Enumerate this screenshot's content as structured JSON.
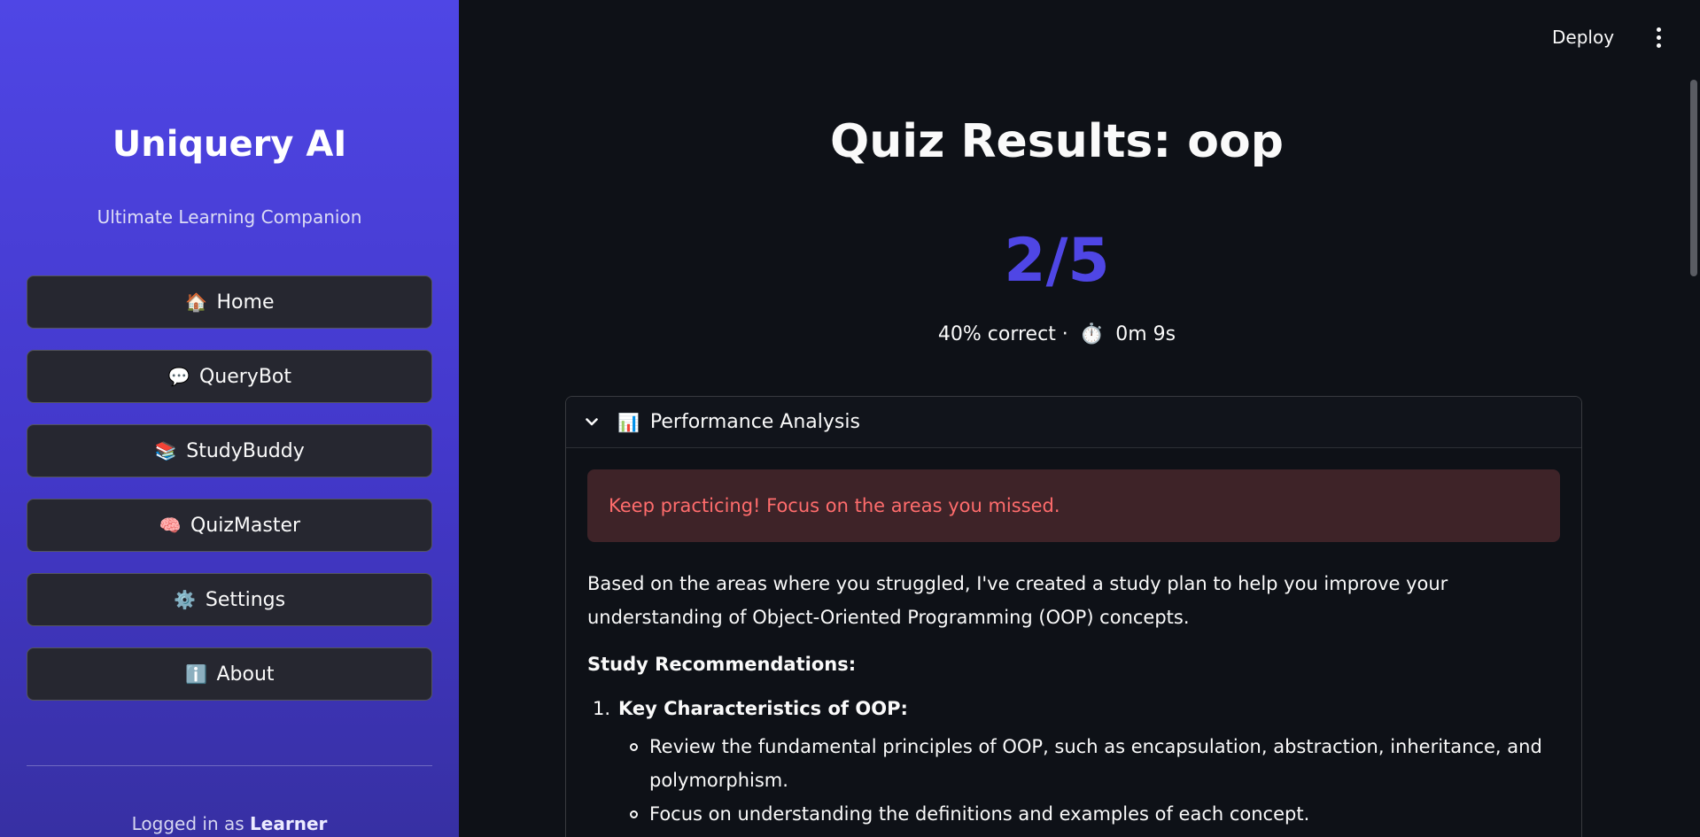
{
  "sidebar": {
    "title": "Uniquery AI",
    "subtitle": "Ultimate Learning Companion",
    "nav": [
      {
        "icon": "🏠",
        "icon_name": "home-icon",
        "label": "Home"
      },
      {
        "icon": "💬",
        "icon_name": "speech-bubble-icon",
        "label": "QueryBot"
      },
      {
        "icon": "📚",
        "icon_name": "books-icon",
        "label": "StudyBuddy"
      },
      {
        "icon": "🧠",
        "icon_name": "brain-icon",
        "label": "QuizMaster"
      },
      {
        "icon": "⚙️",
        "icon_name": "gear-icon",
        "label": "Settings"
      },
      {
        "icon": "ℹ️",
        "icon_name": "info-icon",
        "label": "About"
      }
    ],
    "login_prefix": "Logged in as ",
    "login_user": "Learner"
  },
  "topbar": {
    "deploy_label": "Deploy",
    "menu_icon": "vertical-dots-icon"
  },
  "main": {
    "title": "Quiz Results: oop",
    "score": "2/5",
    "percent_text": "40% correct ·",
    "timer_icon": "⏱️",
    "time_text": "0m 9s",
    "expander": {
      "icon": "📊",
      "title": "Performance Analysis",
      "alert": "Keep practicing! Focus on the areas you missed.",
      "intro": "Based on the areas where you struggled, I've created a study plan to help you improve your understanding of Object-Oriented Programming (OOP) concepts.",
      "heading": "Study Recommendations:",
      "recommendations": [
        {
          "number": "1.",
          "title": "Key Characteristics of OOP:",
          "points": [
            "Review the fundamental principles of OOP, such as encapsulation, abstraction, inheritance, and polymorphism.",
            "Focus on understanding the definitions and examples of each concept."
          ]
        }
      ]
    }
  },
  "colors": {
    "accent": "#4f46e5",
    "sidebar_gradient_top": "#4f46e5",
    "sidebar_gradient_bottom": "#3730a3",
    "background": "#0e1117",
    "button_bg": "#262730",
    "alert_bg": "#3e2328",
    "alert_text": "#ff6c6c"
  }
}
